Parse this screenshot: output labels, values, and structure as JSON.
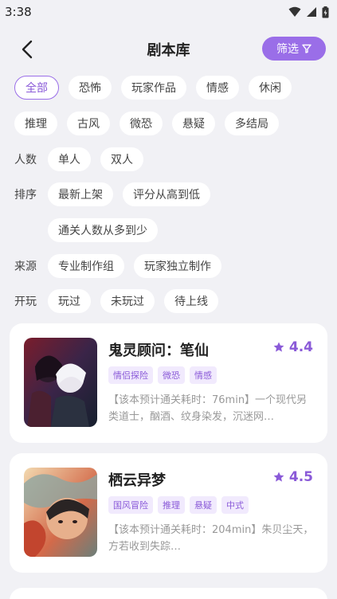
{
  "status_bar": {
    "time": "3:38"
  },
  "header": {
    "title": "剧本库",
    "filter_label": "筛选"
  },
  "genres": [
    "全部",
    "恐怖",
    "玩家作品",
    "情感",
    "休闲",
    "推理",
    "古风",
    "微恐",
    "悬疑",
    "多结局"
  ],
  "players": {
    "label": "人数",
    "options": [
      "单人",
      "双人"
    ]
  },
  "sort": {
    "label": "排序",
    "options": [
      "最新上架",
      "评分从高到低",
      "通关人数从多到少"
    ]
  },
  "source": {
    "label": "来源",
    "options": [
      "专业制作组",
      "玩家独立制作"
    ]
  },
  "played": {
    "label": "开玩",
    "options": [
      "玩过",
      "未玩过",
      "待上线"
    ]
  },
  "scripts": [
    {
      "title": "鬼灵顾问：笔仙",
      "rating": "4.4",
      "tags": [
        "情侣探险",
        "微恐",
        "情感"
      ],
      "description": "【该本预计通关耗时：76min】一个现代另类道士，酗酒、纹身染发，沉迷网…"
    },
    {
      "title": "栖云异梦",
      "rating": "4.5",
      "tags": [
        "国风冒险",
        "推理",
        "悬疑",
        "中式"
      ],
      "description": "【该本预计通关耗时：204min】朱贝尘天，方若收到失踪…"
    }
  ],
  "colors": {
    "accent": "#9a6ee8",
    "background": "#f1f1f5"
  }
}
